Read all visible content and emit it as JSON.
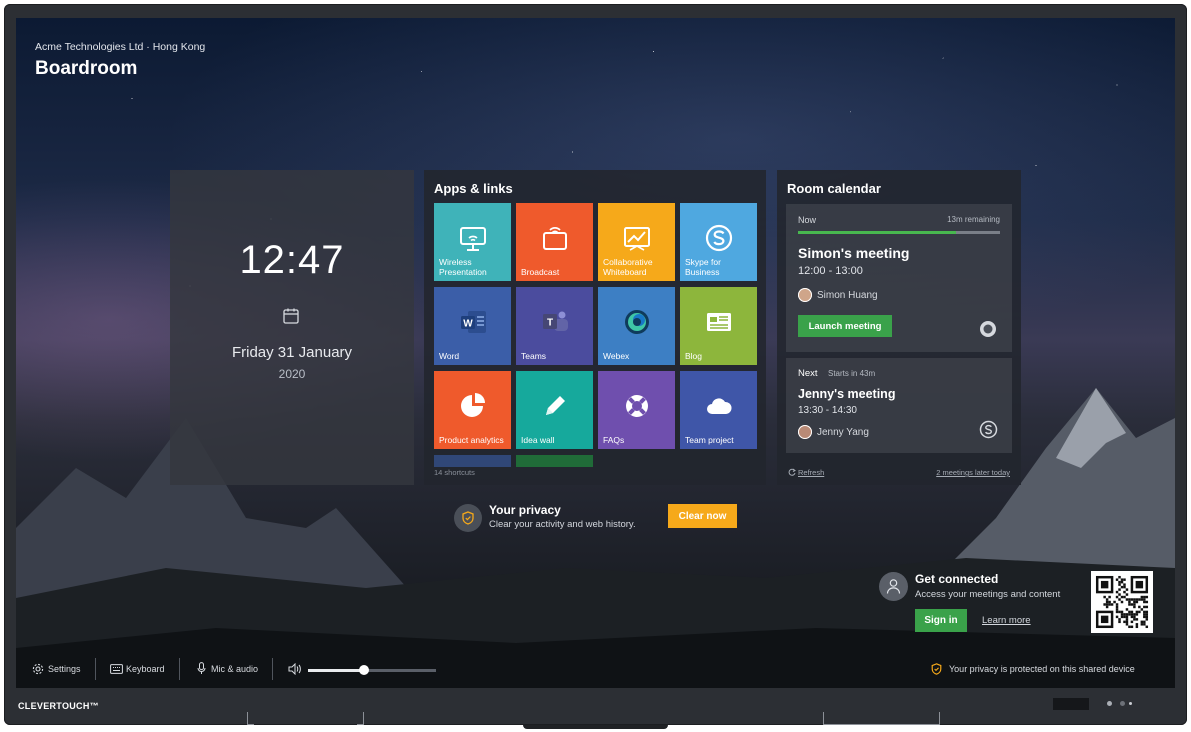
{
  "header": {
    "organization": "Acme Technologies Ltd · Hong Kong",
    "room": "Boardroom"
  },
  "clock": {
    "time": "12:47",
    "date": "Friday 31 January",
    "year": "2020"
  },
  "apps": {
    "title": "Apps & links",
    "tiles": [
      {
        "label": "Wireless Presentation",
        "icon": "wireless-presentation-icon",
        "color": "#3fb3b9"
      },
      {
        "label": "Broadcast",
        "icon": "broadcast-icon",
        "color": "#ef5a2c"
      },
      {
        "label": "Collaborative Whiteboard",
        "icon": "whiteboard-icon",
        "color": "#f6a91a"
      },
      {
        "label": "Skype for Business",
        "icon": "skype-icon",
        "color": "#4fa8e0"
      },
      {
        "label": "Word",
        "icon": "word-icon",
        "color": "#3b5ea8"
      },
      {
        "label": "Teams",
        "icon": "teams-icon",
        "color": "#4b4c9e"
      },
      {
        "label": "Webex",
        "icon": "webex-icon",
        "color": "#3d7fc4"
      },
      {
        "label": "Blog",
        "icon": "blog-icon",
        "color": "#8db63c"
      },
      {
        "label": "Product analytics",
        "icon": "pie-chart-icon",
        "color": "#ef5a2c"
      },
      {
        "label": "Idea wall",
        "icon": "pencil-icon",
        "color": "#16a99c"
      },
      {
        "label": "FAQs",
        "icon": "lifebuoy-icon",
        "color": "#6f4fae"
      },
      {
        "label": "Team project",
        "icon": "cloud-icon",
        "color": "#3f56a8"
      }
    ],
    "shortcuts": "14 shortcuts"
  },
  "calendar": {
    "title": "Room calendar",
    "now": {
      "status": "Now",
      "remaining": "13m remaining",
      "progress": 0.78,
      "title": "Simon's meeting",
      "time": "12:00 - 13:00",
      "organizer": "Simon Huang",
      "launch_label": "Launch meeting",
      "app_icon": "webex-icon"
    },
    "next": {
      "status": "Next",
      "starts": "Starts in 43m",
      "title": "Jenny's meeting",
      "time": "13:30 - 14:30",
      "organizer": "Jenny Yang",
      "app_icon": "skype-icon"
    },
    "refresh": "Refresh",
    "later": "2 meetings later today"
  },
  "privacy": {
    "title": "Your privacy",
    "subtitle": "Clear your activity and web history.",
    "clear_label": "Clear now",
    "footer": "Your privacy is protected on this shared device"
  },
  "connect": {
    "title": "Get connected",
    "subtitle": "Access your meetings and content",
    "signin_label": "Sign in",
    "learn_more": "Learn more"
  },
  "bottombar": {
    "settings": "Settings",
    "keyboard": "Keyboard",
    "mic": "Mic & audio",
    "volume": 0.44
  },
  "device": {
    "brand": "CLEVERTOUCH™"
  },
  "colors": {
    "accent_green": "#3aa24a",
    "accent_orange": "#f6a91a",
    "panel": "#262a32"
  }
}
